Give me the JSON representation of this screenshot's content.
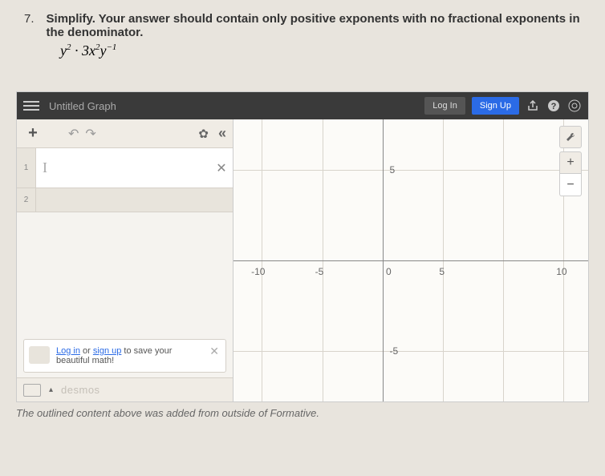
{
  "question": {
    "number": "7.",
    "text": "Simplify. Your answer should contain only positive exponents with no fractional exponents in the denominator.",
    "formula": "y² · 3x²y⁻¹"
  },
  "desmos": {
    "title": "Untitled Graph",
    "login": "Log In",
    "signup": "Sign Up",
    "plus": "+",
    "expr_placeholder": "I",
    "expr_index_1": "1",
    "expr_index_2": "2",
    "promo_login": "Log in",
    "promo_or": " or ",
    "promo_signup": "sign up",
    "promo_text": " to save your beautiful math!",
    "brand": "desmos",
    "axis": {
      "neg10": "-10",
      "neg5": "-5",
      "zero": "0",
      "pos5": "5",
      "pos10": "10",
      "y_pos5": "5",
      "y_neg5": "-5"
    },
    "tools": {
      "wrench": "🔧",
      "zoom_in": "+",
      "zoom_out": "−"
    }
  },
  "footer": "The outlined content above was added from outside of Formative."
}
